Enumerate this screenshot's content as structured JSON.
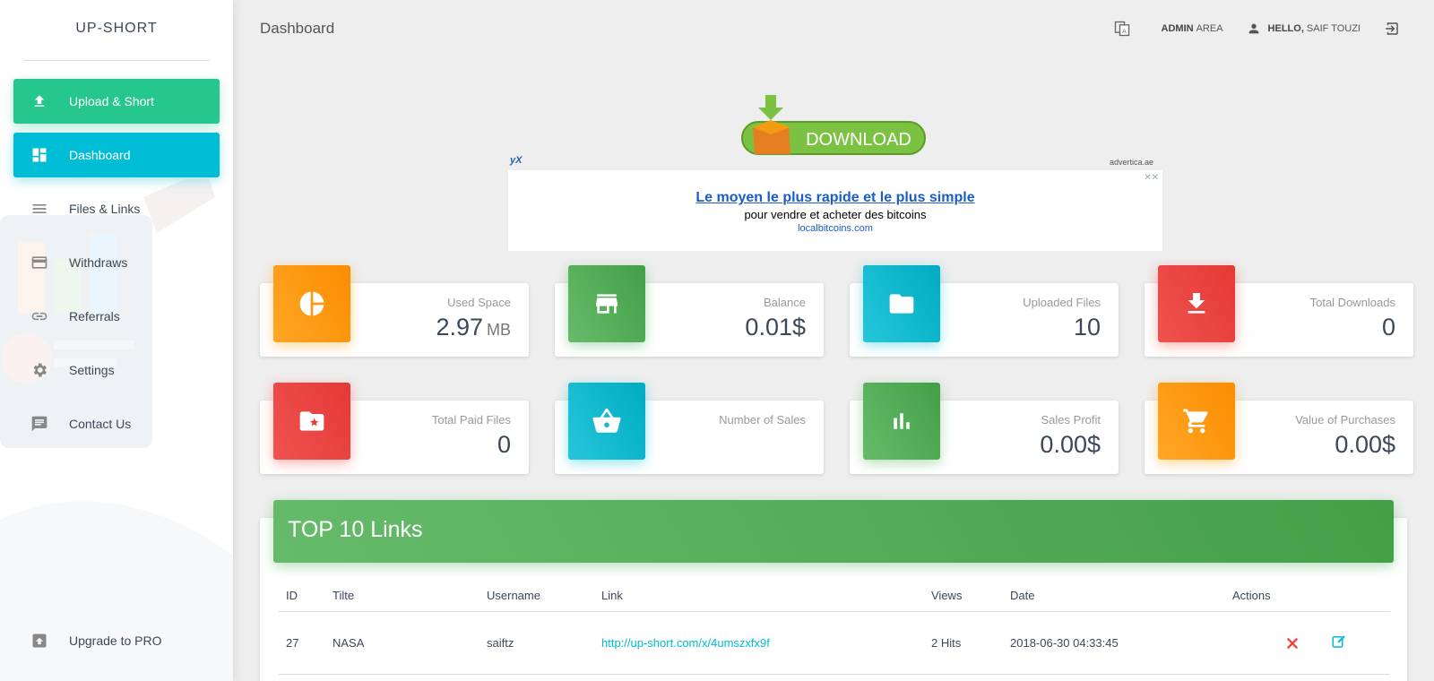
{
  "brand": "UP-SHORT",
  "page_title": "Dashboard",
  "header": {
    "translate_icon": "translate-icon",
    "admin_strong": "ADMIN",
    "admin_rest": "AREA",
    "hello_strong": "HELLO,",
    "hello_rest": "SAIF TOUZI",
    "logout_icon": "logout-icon"
  },
  "sidebar": {
    "items": [
      {
        "label": "Upload & Short",
        "icon": "upload-icon"
      },
      {
        "label": "Dashboard",
        "icon": "dashboard-icon"
      },
      {
        "label": "Files & Links",
        "icon": "list-icon"
      },
      {
        "label": "Withdraws",
        "icon": "credit-card-icon"
      },
      {
        "label": "Referrals",
        "icon": "link-icon"
      },
      {
        "label": "Settings",
        "icon": "gear-icon"
      },
      {
        "label": "Contact Us",
        "icon": "chat-icon"
      }
    ],
    "upgrade": {
      "label": "Upgrade to PRO",
      "icon": "upgrade-icon"
    }
  },
  "ad": {
    "banner_text": "DOWNLOAD",
    "source": "advertica.ae",
    "logo": "yX",
    "headline": "Le moyen le plus rapide et le plus simple",
    "sub": "pour vendre et acheter des bitcoins",
    "url": "localbitcoins.com"
  },
  "cards": [
    {
      "label": "Used Space",
      "value": "2.97",
      "unit": "MB",
      "color": "#fb8c00",
      "icon": "pie-chart-icon"
    },
    {
      "label": "Balance",
      "value": "0.01$",
      "unit": "",
      "color": "#43a047",
      "icon": "store-icon"
    },
    {
      "label": "Uploaded Files",
      "value": "10",
      "unit": "",
      "color": "#00acc1",
      "icon": "folder-icon"
    },
    {
      "label": "Total Downloads",
      "value": "0",
      "unit": "",
      "color": "#e53935",
      "icon": "download-icon"
    },
    {
      "label": "Total Paid Files",
      "value": "0",
      "unit": "",
      "color": "#e53935",
      "icon": "folder-star-icon"
    },
    {
      "label": "Number of Sales",
      "value": "",
      "unit": "",
      "color": "#00acc1",
      "icon": "basket-icon"
    },
    {
      "label": "Sales Profit",
      "value": "0.00$",
      "unit": "",
      "color": "#43a047",
      "icon": "bar-chart-icon"
    },
    {
      "label": "Value of Purchases",
      "value": "0.00$",
      "unit": "",
      "color": "#fb8c00",
      "icon": "cart-icon"
    }
  ],
  "top_links": {
    "title": "TOP 10 Links",
    "columns": [
      "ID",
      "Tilte",
      "Username",
      "Link",
      "Views",
      "Date",
      "Actions"
    ],
    "rows": [
      {
        "id": "27",
        "title": "NASA",
        "username": "saiftz",
        "link": "http://up-short.com/x/4umszxfx9f",
        "views": "2 Hits",
        "date": "2018-06-30 04:33:45"
      }
    ]
  }
}
